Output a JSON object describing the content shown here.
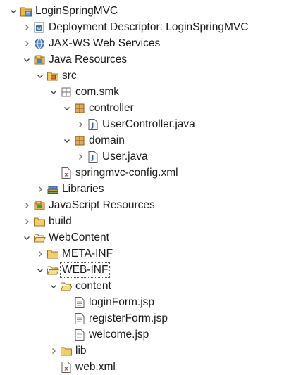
{
  "tree": [
    {
      "label": "LoginSpringMVC",
      "depth": 0,
      "twisty": "expanded",
      "icon": "project-icon"
    },
    {
      "label": "Deployment Descriptor: LoginSpringMVC",
      "depth": 1,
      "twisty": "collapsed",
      "icon": "deployment-descriptor-icon"
    },
    {
      "label": "JAX-WS Web Services",
      "depth": 1,
      "twisty": "collapsed",
      "icon": "webservices-icon"
    },
    {
      "label": "Java Resources",
      "depth": 1,
      "twisty": "expanded",
      "icon": "java-resources-icon"
    },
    {
      "label": "src",
      "depth": 2,
      "twisty": "expanded",
      "icon": "source-folder-icon"
    },
    {
      "label": "com.smk",
      "depth": 3,
      "twisty": "expanded",
      "icon": "package-empty-icon"
    },
    {
      "label": "controller",
      "depth": 4,
      "twisty": "expanded",
      "icon": "package-icon"
    },
    {
      "label": "UserController.java",
      "depth": 5,
      "twisty": "collapsed",
      "icon": "java-file-icon"
    },
    {
      "label": "domain",
      "depth": 4,
      "twisty": "expanded",
      "icon": "package-icon"
    },
    {
      "label": "User.java",
      "depth": 5,
      "twisty": "collapsed",
      "icon": "java-file-icon"
    },
    {
      "label": "springmvc-config.xml",
      "depth": 3,
      "twisty": "none",
      "icon": "xml-file-icon"
    },
    {
      "label": "Libraries",
      "depth": 2,
      "twisty": "collapsed",
      "icon": "libraries-icon"
    },
    {
      "label": "JavaScript Resources",
      "depth": 1,
      "twisty": "collapsed",
      "icon": "javascript-resources-icon"
    },
    {
      "label": "build",
      "depth": 1,
      "twisty": "collapsed",
      "icon": "folder-icon"
    },
    {
      "label": "WebContent",
      "depth": 1,
      "twisty": "expanded",
      "icon": "folder-open-icon"
    },
    {
      "label": "META-INF",
      "depth": 2,
      "twisty": "collapsed",
      "icon": "folder-icon"
    },
    {
      "label": "WEB-INF",
      "depth": 2,
      "twisty": "expanded",
      "icon": "folder-open-icon",
      "focused": true
    },
    {
      "label": "content",
      "depth": 3,
      "twisty": "expanded",
      "icon": "folder-open-icon"
    },
    {
      "label": "loginForm.jsp",
      "depth": 4,
      "twisty": "none",
      "icon": "file-icon"
    },
    {
      "label": "registerForm.jsp",
      "depth": 4,
      "twisty": "none",
      "icon": "file-icon"
    },
    {
      "label": "welcome.jsp",
      "depth": 4,
      "twisty": "none",
      "icon": "file-icon"
    },
    {
      "label": "lib",
      "depth": 3,
      "twisty": "collapsed",
      "icon": "folder-icon"
    },
    {
      "label": "web.xml",
      "depth": 3,
      "twisty": "none",
      "icon": "xml-file-icon"
    }
  ]
}
